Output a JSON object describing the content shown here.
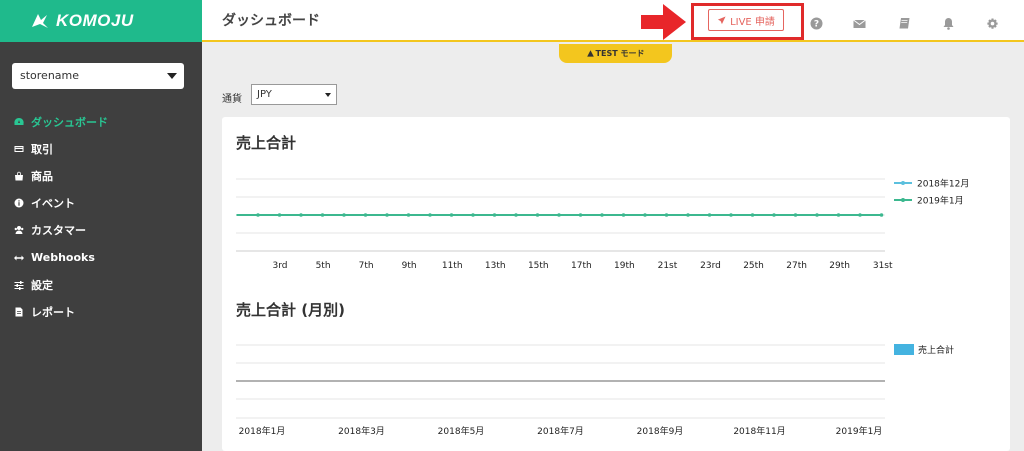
{
  "brand": {
    "name": "KOMOJU"
  },
  "store_select": {
    "value": "storename"
  },
  "nav": [
    {
      "label": "ダッシュボード",
      "icon": "dashboard-icon",
      "active": true
    },
    {
      "label": "取引",
      "icon": "card-icon"
    },
    {
      "label": "商品",
      "icon": "bag-icon"
    },
    {
      "label": "イベント",
      "icon": "info-icon"
    },
    {
      "label": "カスタマー",
      "icon": "users-icon"
    },
    {
      "label": "Webhooks",
      "icon": "arrows-icon"
    },
    {
      "label": "設定",
      "icon": "sliders-icon"
    },
    {
      "label": "レポート",
      "icon": "document-icon"
    }
  ],
  "header": {
    "title": "ダッシュボード",
    "live_button": "LIVE 申請",
    "icons": [
      "help-icon",
      "mail-icon",
      "book-icon",
      "bell-icon",
      "gear-icon"
    ]
  },
  "test_mode": {
    "label": "TEST モード"
  },
  "currency": {
    "label": "通貨",
    "value": "JPY"
  },
  "colors": {
    "accent": "#1fba8c",
    "warning": "#f3c61e",
    "highlight": "#e02a2a",
    "series_dec": "#5bc0de",
    "series_jan": "#3cb88f",
    "bar_series": "#44b3e0"
  },
  "chart_data": [
    {
      "type": "line",
      "title": "売上合計",
      "x": [
        "3rd",
        "5th",
        "7th",
        "9th",
        "11th",
        "13th",
        "15th",
        "17th",
        "19th",
        "21st",
        "23rd",
        "25th",
        "27th",
        "29th",
        "31st"
      ],
      "series": [
        {
          "name": "2018年12月",
          "values": [
            0,
            0,
            0,
            0,
            0,
            0,
            0,
            0,
            0,
            0,
            0,
            0,
            0,
            0,
            0,
            0,
            0,
            0,
            0,
            0,
            0,
            0,
            0,
            0,
            0,
            0,
            0,
            0,
            0,
            0,
            0
          ]
        },
        {
          "name": "2019年1月",
          "values": [
            0,
            0,
            0,
            0,
            0,
            0,
            0,
            0,
            0,
            0,
            0,
            0,
            0,
            0,
            0,
            0,
            0,
            0,
            0,
            0,
            0,
            0,
            0,
            0,
            0,
            0,
            0,
            0,
            0,
            0,
            0
          ]
        }
      ],
      "legend": "right"
    },
    {
      "type": "bar",
      "title": "売上合計 (月別)",
      "categories": [
        "2018年1月",
        "2018年3月",
        "2018年5月",
        "2018年7月",
        "2018年9月",
        "2018年11月",
        "2019年1月"
      ],
      "series": [
        {
          "name": "売上合計",
          "values": [
            0,
            0,
            0,
            0,
            0,
            0,
            0
          ]
        }
      ],
      "legend": "right"
    }
  ]
}
